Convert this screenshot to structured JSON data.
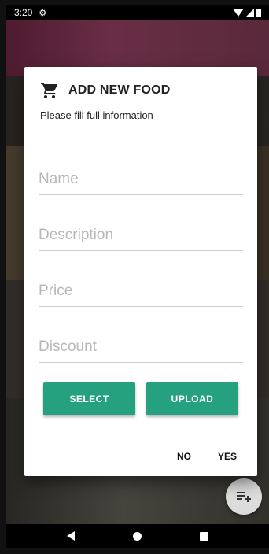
{
  "status_bar": {
    "time": "3:20",
    "icons": [
      "settings-icon",
      "wifi-icon",
      "signal-icon",
      "battery-icon"
    ]
  },
  "dialog": {
    "icon": "shopping-cart-icon",
    "title": "ADD NEW FOOD",
    "subtitle": "Please fill full information",
    "fields": {
      "name": {
        "value": "",
        "placeholder": "Name"
      },
      "description": {
        "value": "",
        "placeholder": "Description"
      },
      "price": {
        "value": "",
        "placeholder": "Price"
      },
      "discount": {
        "value": "",
        "placeholder": "Discount"
      }
    },
    "buttons": {
      "select": "SELECT",
      "upload": "UPLOAD"
    },
    "actions": {
      "no": "NO",
      "yes": "YES"
    }
  },
  "fab": {
    "icon": "add-to-list-icon"
  },
  "nav_bar": {
    "icons": [
      "back-icon",
      "home-icon",
      "recent-apps-icon"
    ]
  },
  "colors": {
    "accent": "#26a17f",
    "dialog_bg": "#ffffff",
    "status_bar": "#000000"
  }
}
